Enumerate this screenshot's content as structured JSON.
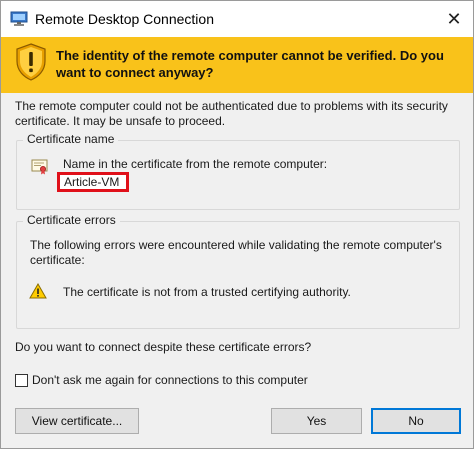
{
  "window": {
    "title": "Remote Desktop Connection",
    "close_glyph": "✕"
  },
  "banner": {
    "message": "The identity of the remote computer cannot be verified. Do you want to connect anyway?",
    "color": "#f9c21a"
  },
  "intro_text": "The remote computer could not be authenticated due to problems with its security certificate. It may be unsafe to proceed.",
  "certificate_name": {
    "group_label": "Certificate name",
    "label": "Name in the certificate from the remote computer:",
    "value": "Article-VM",
    "highlight_color": "#e0101a"
  },
  "certificate_errors": {
    "group_label": "Certificate errors",
    "description": "The following errors were encountered while validating the remote computer's certificate:",
    "items": [
      "The certificate is not from a trusted certifying authority."
    ]
  },
  "question": "Do you want to connect despite these certificate errors?",
  "dont_ask": {
    "label": "Don't ask me again for connections to this computer",
    "checked": false
  },
  "buttons": {
    "view_certificate": "View certificate...",
    "yes": "Yes",
    "no": "No",
    "default_focus_color": "#0078d7"
  },
  "icons": {
    "app": "remote-desktop-icon",
    "shield": "warning-shield-icon",
    "certificate": "certificate-icon",
    "warning": "warning-triangle-icon"
  }
}
